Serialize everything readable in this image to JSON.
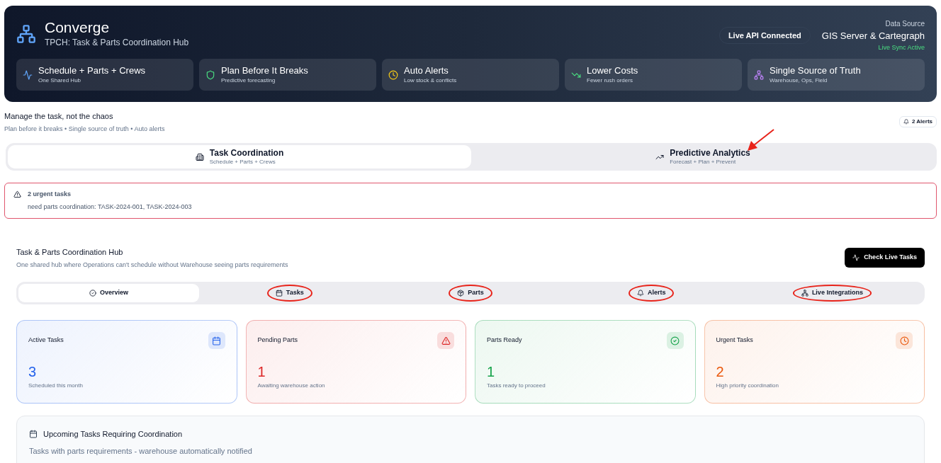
{
  "header": {
    "title": "Converge",
    "subtitle": "TPCH: Task & Parts Coordination Hub",
    "status_badge": "Live API Connected",
    "source_label": "Data Source",
    "source_name": "GIS Server & Cartegraph",
    "sync_status": "Live Sync Active",
    "features": [
      {
        "title": "Schedule + Parts + Crews",
        "subtitle": "One Shared Hub"
      },
      {
        "title": "Plan Before It Breaks",
        "subtitle": "Predictive forecasting"
      },
      {
        "title": "Auto Alerts",
        "subtitle": "Low stock & conflicts"
      },
      {
        "title": "Lower Costs",
        "subtitle": "Fewer rush orders"
      },
      {
        "title": "Single Source of Truth",
        "subtitle": "Warehouse, Ops, Field"
      }
    ]
  },
  "tagline": {
    "title": "Manage the task, not the chaos",
    "subtitle": "Plan before it breaks • Single source of truth • Auto alerts"
  },
  "alerts_badge": "2 Alerts",
  "main_tabs": [
    {
      "label": "Task Coordination",
      "subtitle": "Schedule + Parts + Crews",
      "selected": true,
      "annotated": false
    },
    {
      "label": "Predictive Analytics",
      "subtitle": "Forecast + Plan + Prevent",
      "selected": false,
      "annotated": true
    }
  ],
  "urgent_banner": {
    "title": "2 urgent tasks",
    "message": "need parts coordination: TASK-2024-001, TASK-2024-003"
  },
  "hub": {
    "title": "Task & Parts Coordination Hub",
    "subtitle": "One shared hub where Operations can't schedule without Warehouse seeing parts requirements",
    "action": "Check Live Tasks",
    "tabs": [
      {
        "label": "Overview",
        "selected": true,
        "annotated": false
      },
      {
        "label": "Tasks",
        "selected": false,
        "annotated": true
      },
      {
        "label": "Parts",
        "selected": false,
        "annotated": true
      },
      {
        "label": "Alerts",
        "selected": false,
        "annotated": true
      },
      {
        "label": "Live Integrations",
        "selected": false,
        "annotated": true
      }
    ],
    "stats": [
      {
        "label": "Active Tasks",
        "value": "3",
        "note": "Scheduled this month",
        "color": "#2563eb"
      },
      {
        "label": "Pending Parts",
        "value": "1",
        "note": "Awaiting warehouse action",
        "color": "#dc2626"
      },
      {
        "label": "Parts Ready",
        "value": "1",
        "note": "Tasks ready to proceed",
        "color": "#16a34a"
      },
      {
        "label": "Urgent Tasks",
        "value": "2",
        "note": "High priority coordination",
        "color": "#ea580c"
      }
    ],
    "upcoming": {
      "title": "Upcoming Tasks Requiring Coordination",
      "subtitle": "Tasks with parts requirements - warehouse automatically notified"
    }
  }
}
